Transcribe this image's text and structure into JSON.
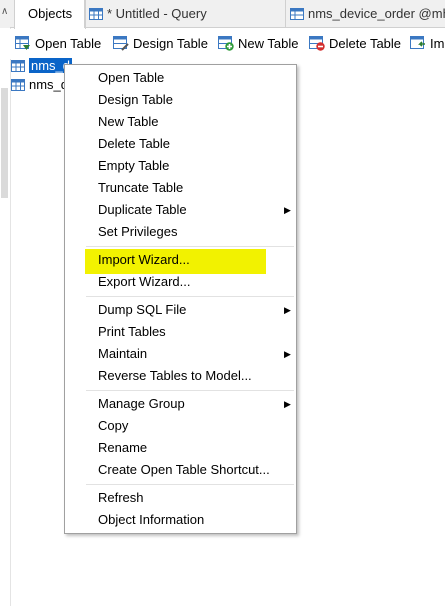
{
  "tabs": {
    "objects": "Objects",
    "query": "* Untitled - Query",
    "table": "nms_device_order @mhs"
  },
  "toolbar": {
    "open_table": "Open Table",
    "design_table": "Design Table",
    "new_table": "New Table",
    "delete_table": "Delete Table",
    "import_partial": "Im"
  },
  "objects": [
    {
      "label": "nms_d",
      "selected": true
    },
    {
      "label": "nms_d",
      "selected": false
    }
  ],
  "context_menu": {
    "group1": [
      "Open Table",
      "Design Table",
      "New Table",
      "Delete Table",
      "Empty Table",
      "Truncate Table",
      "Duplicate Table",
      "Set Privileges"
    ],
    "group2": [
      "Import Wizard...",
      "Export Wizard..."
    ],
    "group3": [
      "Dump SQL File",
      "Print Tables",
      "Maintain",
      "Reverse Tables to Model..."
    ],
    "group4": [
      "Manage Group",
      "Copy",
      "Rename",
      "Create Open Table Shortcut..."
    ],
    "group5": [
      "Refresh",
      "Object Information"
    ],
    "highlighted_item": "Import Wizard...",
    "highlight_color": "#f2f200"
  },
  "colors": {
    "selection": "#0a64c8",
    "table_icon": "#3b78c2"
  }
}
